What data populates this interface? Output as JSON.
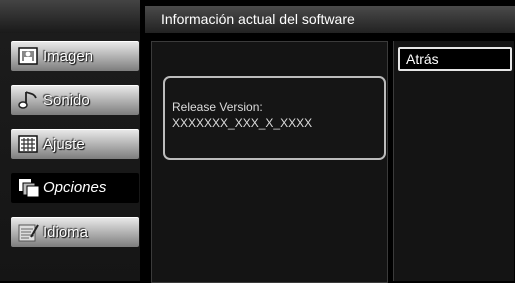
{
  "header": {
    "title": "Información actual del software"
  },
  "sidebar": {
    "items": [
      {
        "label": "Imagen",
        "icon": "picture-icon"
      },
      {
        "label": "Sonido",
        "icon": "music-note-icon"
      },
      {
        "label": "Ajuste",
        "icon": "grid-icon"
      },
      {
        "label": "Opciones",
        "icon": "options-icon",
        "selected": true
      },
      {
        "label": "Idioma",
        "icon": "language-icon"
      }
    ]
  },
  "main": {
    "info_label": "Release Version:",
    "info_value": "XXXXXXX_XXX_X_XXXX"
  },
  "actions": {
    "back_label": "Atrás"
  },
  "colors": {
    "button_light": "#e0e0e0",
    "button_dark": "#7d7d7d",
    "background": "#000000",
    "panel": "#141414"
  }
}
